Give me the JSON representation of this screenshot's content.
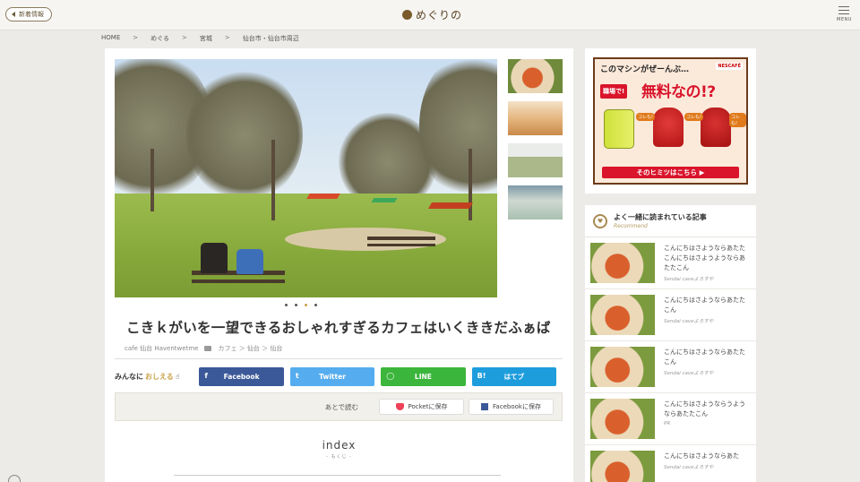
{
  "header": {
    "news_label": "新着情報",
    "logo_text": "めぐりの",
    "menu_label": "MENU"
  },
  "breadcrumb": [
    "HOME",
    "めぐる",
    "宮城",
    "仙台市・仙台市周辺"
  ],
  "breadcrumb_sep": ">",
  "article": {
    "title": "こきｋがいを一望できるおしゃれすぎるカフェはいくききだふぁば",
    "author": "cafe 仙台 Haventwetme",
    "categories": "カフェ ＞ 仙台 ＞ 仙台"
  },
  "share": {
    "label_prefix": "みんなに",
    "label_emph": "おしえる",
    "buttons": [
      {
        "label": "Facebook",
        "icon": "f"
      },
      {
        "label": "Twitter",
        "icon": "t"
      },
      {
        "label": "LINE",
        "icon": "◯"
      },
      {
        "label": "はてブ",
        "icon": "B!"
      }
    ]
  },
  "read_later": {
    "label": "あとで読む",
    "pocket": "Pocketに保存",
    "facebook": "Facebookに保存"
  },
  "index": {
    "title": "index",
    "sub": "- もくじ -"
  },
  "ad": {
    "top": "このマシンがぜーんぶ…",
    "brand": "NESCAFÉ",
    "tag": "職場で!",
    "free": "無料なの!?",
    "koremo": "コレも!",
    "bottom": "そのヒミツはこちら ▶"
  },
  "recommend": {
    "title": "よく一緒に読まれている記事",
    "subtitle": "Recommend",
    "items": [
      {
        "text": "こんにちはさようならあたたこんにちはさようようならあたたこん",
        "src": "Sendai caveよろすや"
      },
      {
        "text": "こんにちはさようならあたたこん",
        "src": "Sendai caveよろすや"
      },
      {
        "text": "こんにちはさようならあたたこん",
        "src": "Sendai caveよろすや"
      },
      {
        "text": "こんにちはさようならうようならあたたこん",
        "src": "PR"
      },
      {
        "text": "こんにちはさようならあた",
        "src": "Sendai caveよろすや"
      }
    ]
  },
  "colors": {
    "facebook": "#3b5998",
    "twitter": "#55acee",
    "line": "#3cb53c",
    "hatena": "#1e9ddd",
    "accent": "#c9a24a"
  },
  "carousel": {
    "count": 4,
    "active": 2
  }
}
